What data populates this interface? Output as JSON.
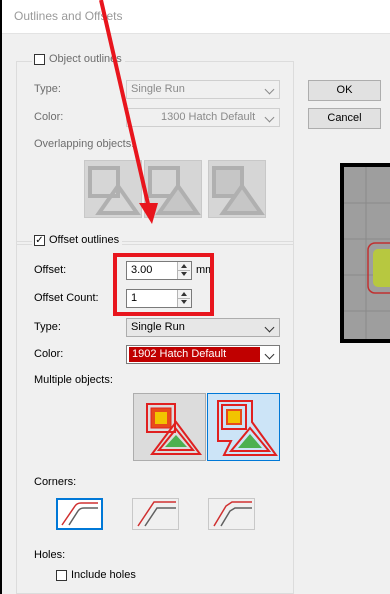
{
  "dialog": {
    "title": "Outlines and Offsets"
  },
  "object_outlines": {
    "checkbox_label": "Object outlines",
    "checked": false,
    "type_label": "Type:",
    "type_value": "Single Run",
    "color_label": "Color:",
    "color_value": "1300 Hatch Default",
    "overlapping_label": "Overlapping objects:"
  },
  "buttons": {
    "ok": "OK",
    "cancel": "Cancel"
  },
  "offset_outlines": {
    "checkbox_label": "Offset outlines",
    "checked": true,
    "checkmark": "✓",
    "offset_label": "Offset:",
    "offset_value": "3.00",
    "offset_unit": "mm",
    "count_label": "Offset Count:",
    "count_value": "1",
    "type_label": "Type:",
    "type_value": "Single Run",
    "color_label": "Color:",
    "color_value": "1902 Hatch Default",
    "color_swatch": "#c00000",
    "multiple_label": "Multiple objects:",
    "corners_label": "Corners:",
    "holes_label": "Holes:",
    "include_holes_label": "Include holes",
    "include_holes_checked": false
  },
  "annotation": {
    "color": "#e8151d"
  }
}
